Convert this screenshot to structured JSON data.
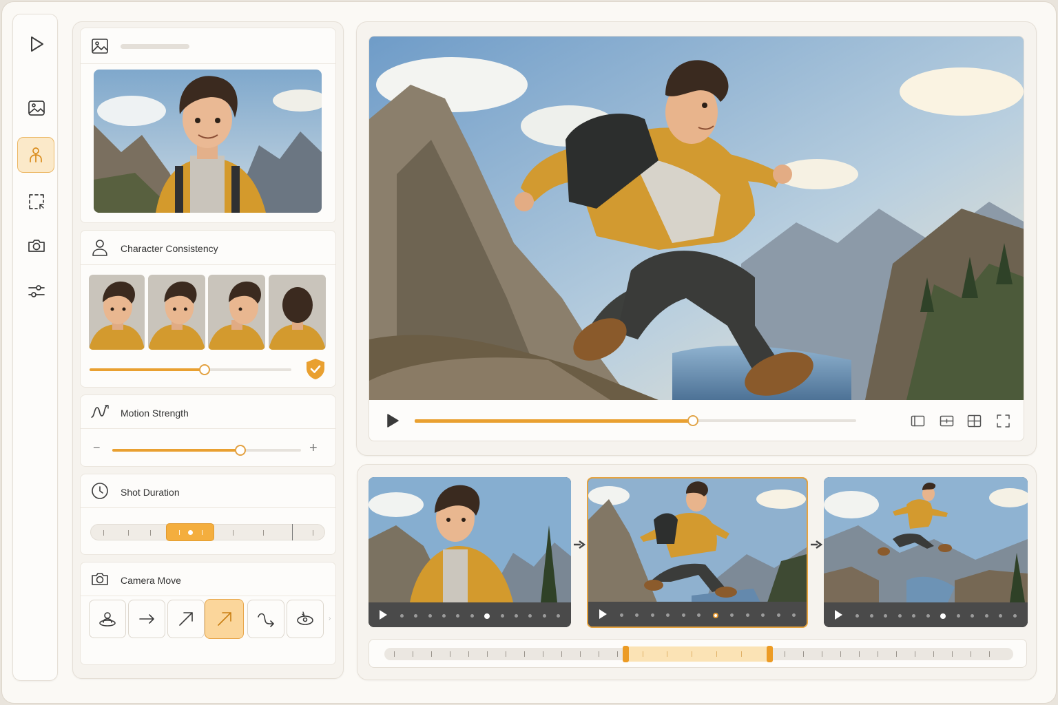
{
  "sidebar": {
    "items": [
      {
        "name": "play-icon",
        "active": false
      },
      {
        "name": "image-icon",
        "active": false
      },
      {
        "name": "character-icon",
        "active": true
      },
      {
        "name": "selection-icon",
        "active": false
      },
      {
        "name": "camera-icon",
        "active": false
      },
      {
        "name": "sliders-icon",
        "active": false
      }
    ]
  },
  "reference": {
    "icon": "image-icon"
  },
  "character_consistency": {
    "title": "Character Consistency",
    "icon": "person-icon",
    "views": [
      "front",
      "three-quarter",
      "profile",
      "back"
    ],
    "value": 0.57,
    "badge_icon": "shield-check-icon"
  },
  "motion_strength": {
    "title": "Motion Strength",
    "icon": "motion-wave-icon",
    "minus": "−",
    "plus": "+",
    "value": 0.68
  },
  "shot_duration": {
    "title": "Shot Duration",
    "icon": "clock-icon"
  },
  "camera_move": {
    "title": "Camera Move",
    "icon": "camera-icon",
    "options": [
      "orbit-person-icon",
      "arrow-right-icon",
      "arrow-diagonal-icon",
      "arrow-diagonal-icon",
      "curve-arrow-icon",
      "orbit-icon"
    ],
    "selected": 3
  },
  "player": {
    "progress": 0.63,
    "controls": [
      "layout-sidebar-icon",
      "layout-split-icon",
      "layout-grid-icon",
      "fullscreen-icon"
    ]
  },
  "shots": [
    {
      "name": "shot-1",
      "selected": false,
      "progress_dot": 6
    },
    {
      "name": "shot-2",
      "selected": true,
      "progress_dot": 6
    },
    {
      "name": "shot-3",
      "selected": false,
      "progress_dot": 6
    }
  ],
  "colors": {
    "accent": "#e9a030",
    "accent_light": "#fbe9c9",
    "panel": "#f6f3ee"
  }
}
